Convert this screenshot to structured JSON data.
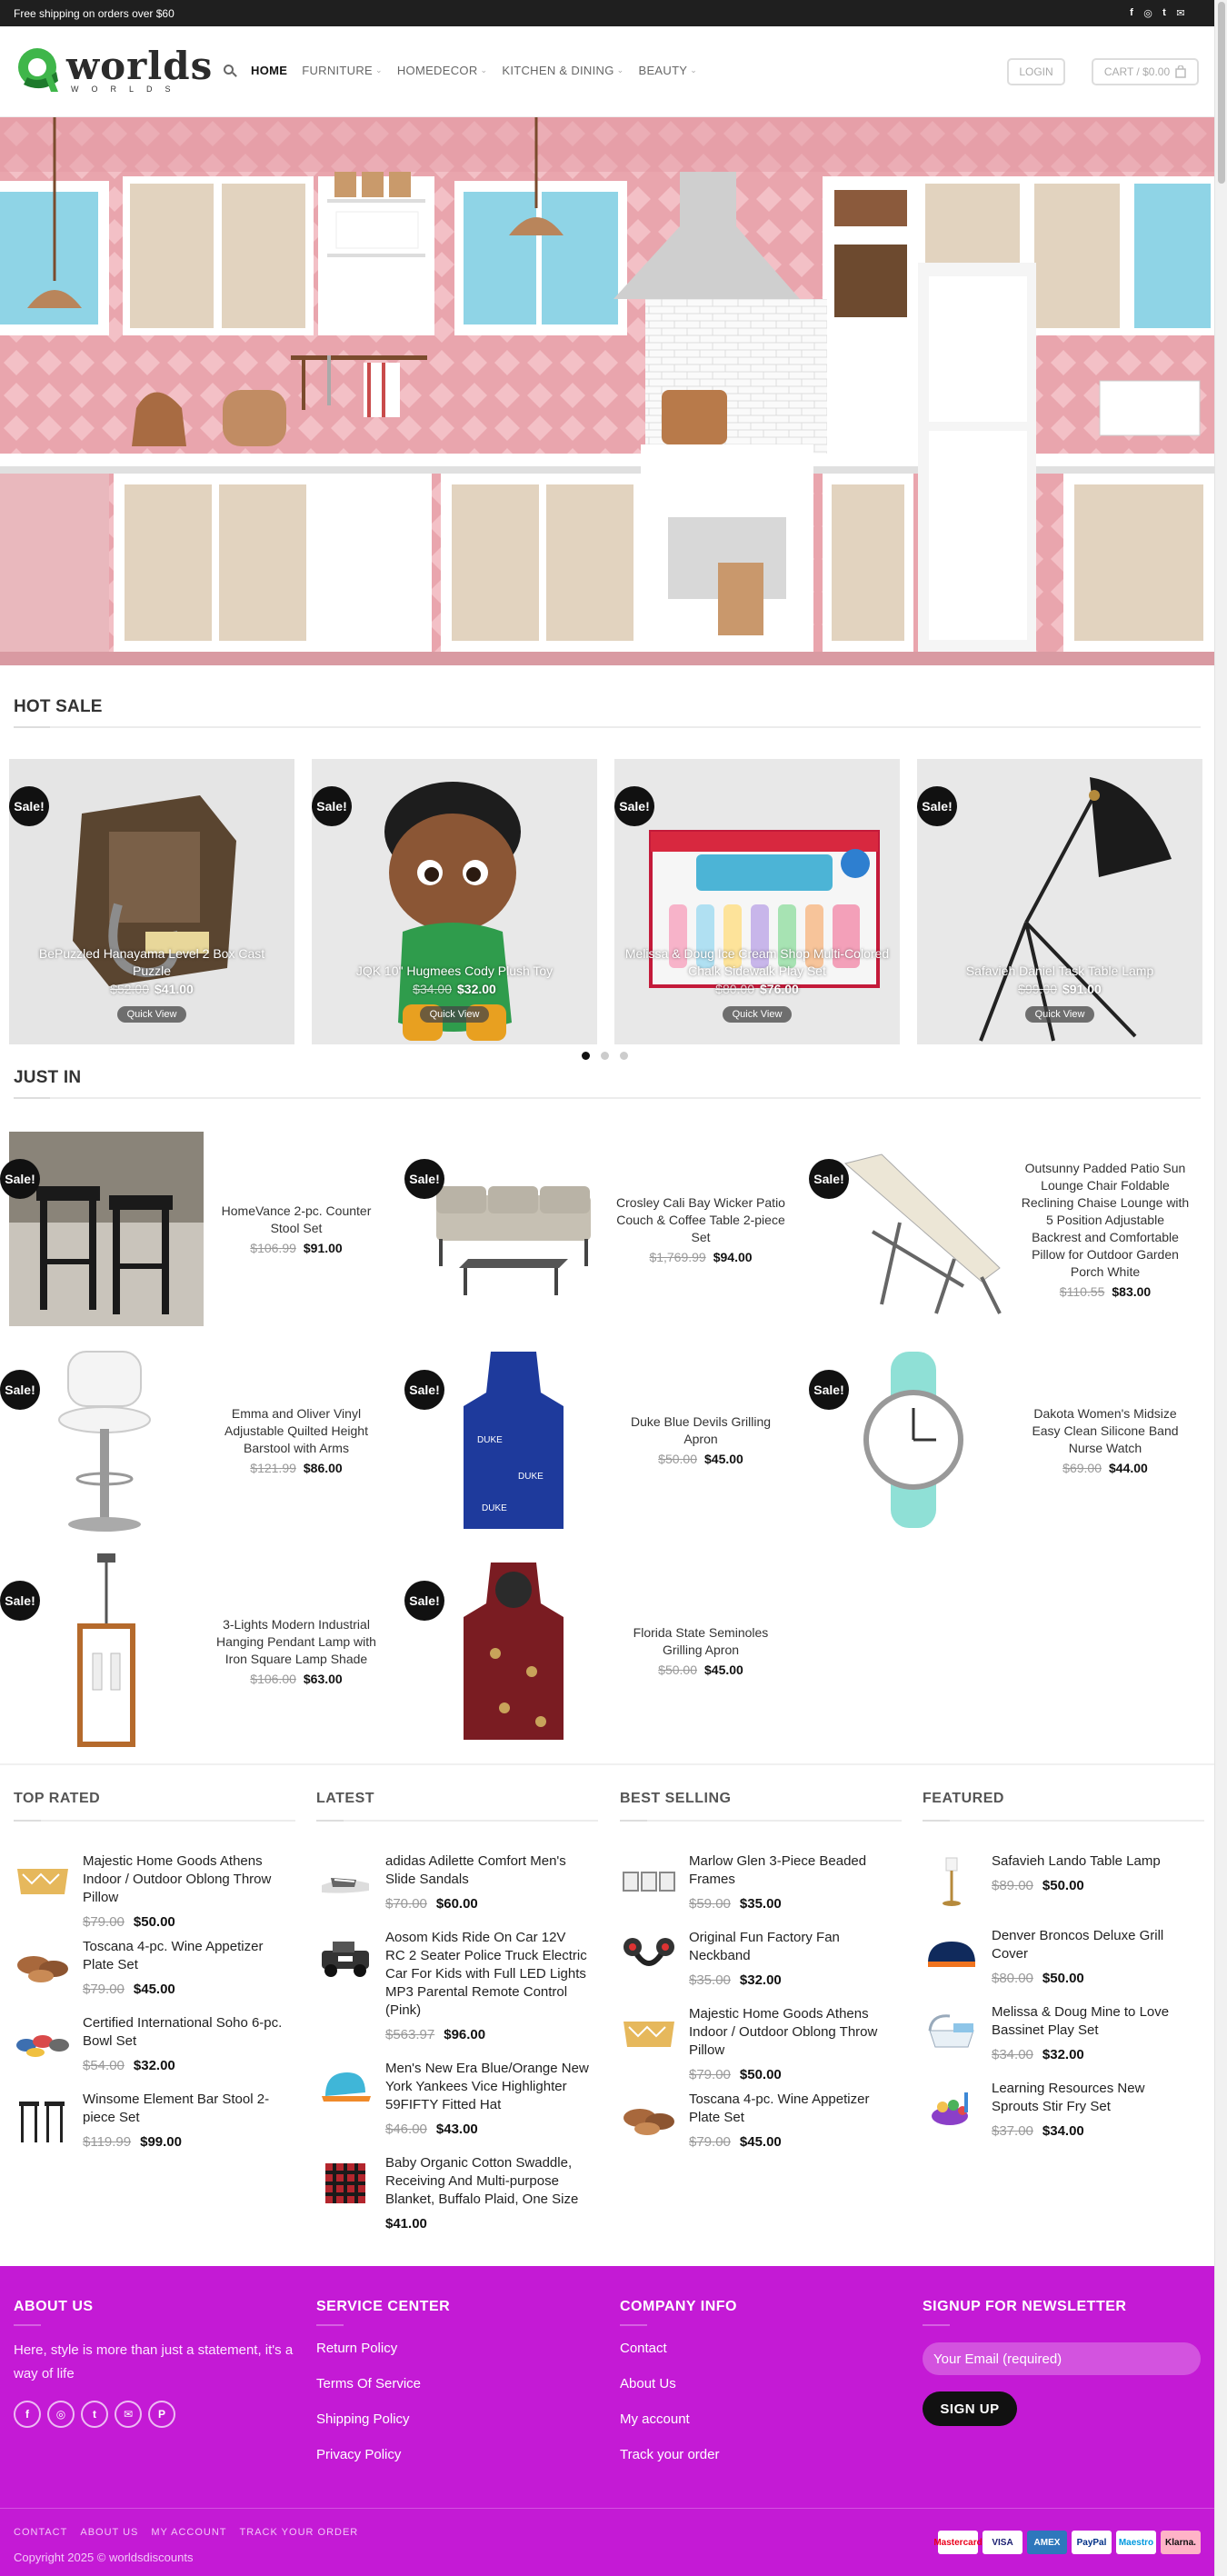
{
  "topbar": {
    "promo": "Free shipping on orders over $60",
    "socials": [
      "facebook-icon",
      "instagram-icon",
      "twitter-icon",
      "email-icon"
    ]
  },
  "brand": {
    "name": "worlds",
    "sub": "WORLDS",
    "accent": "#c41ad5"
  },
  "nav": {
    "items": [
      {
        "label": "HOME",
        "dropdown": false,
        "active": true
      },
      {
        "label": "FURNITURE",
        "dropdown": true
      },
      {
        "label": "HOMEDECOR",
        "dropdown": true
      },
      {
        "label": "KITCHEN & DINING",
        "dropdown": true
      },
      {
        "label": "BEAUTY",
        "dropdown": true
      }
    ],
    "login": "LOGIN",
    "cart": "CART / $0.00"
  },
  "hot_sale": {
    "title": "HOT SALE",
    "badge": "Sale!",
    "quick_view": "Quick View",
    "products": [
      {
        "name": "BePuzzled Hanayama Level 2 Box Cast Puzzle",
        "old": "$52.00",
        "price": "$41.00"
      },
      {
        "name": "JQK 10\" Hugmees Cody Plush Toy",
        "old": "$34.00",
        "price": "$32.00"
      },
      {
        "name": "Melissa & Doug Ice Cream Shop Multi-Colored Chalk Sidewalk Play Set",
        "old": "$80.00",
        "price": "$76.00"
      },
      {
        "name": "Safavieh Daniel Task Table Lamp",
        "old": "$99.00",
        "price": "$91.00"
      }
    ]
  },
  "just_in": {
    "title": "JUST IN",
    "products": [
      {
        "name": "HomeVance 2-pc. Counter Stool Set",
        "old": "$106.99",
        "price": "$91.00",
        "sale": true
      },
      {
        "name": "Crosley Cali Bay Wicker Patio Couch & Coffee Table 2-piece Set",
        "old": "$1,769.99",
        "price": "$94.00",
        "sale": true
      },
      {
        "name": "Outsunny Padded Patio Sun Lounge Chair Foldable Reclining Chaise Lounge with 5 Position Adjustable Backrest and Comfortable Pillow for Outdoor Garden Porch White",
        "old": "$110.55",
        "price": "$83.00",
        "sale": true
      },
      {
        "name": "Emma and Oliver Vinyl Adjustable Quilted Height Barstool with Arms",
        "old": "$121.99",
        "price": "$86.00",
        "sale": true
      },
      {
        "name": "Duke Blue Devils Grilling Apron",
        "old": "$50.00",
        "price": "$45.00",
        "sale": true
      },
      {
        "name": "Dakota Women's Midsize Easy Clean Silicone Band Nurse Watch",
        "old": "$69.00",
        "price": "$44.00",
        "sale": true
      },
      {
        "name": "3-Lights Modern Industrial Hanging Pendant Lamp with Iron Square Lamp Shade",
        "old": "$106.00",
        "price": "$63.00",
        "sale": true
      },
      {
        "name": "Florida State Seminoles Grilling Apron",
        "old": "$50.00",
        "price": "$45.00",
        "sale": true
      }
    ]
  },
  "widgets": [
    {
      "title": "TOP RATED",
      "items": [
        {
          "name": "Majestic Home Goods Athens Indoor / Outdoor Oblong Throw Pillow",
          "old": "$79.00",
          "price": "$50.00"
        },
        {
          "name": "Toscana 4-pc. Wine Appetizer Plate Set",
          "old": "$79.00",
          "price": "$45.00"
        },
        {
          "name": "Certified International Soho 6-pc. Bowl Set",
          "old": "$54.00",
          "price": "$32.00"
        },
        {
          "name": "Winsome Element Bar Stool 2-piece Set",
          "old": "$119.99",
          "price": "$99.00"
        }
      ]
    },
    {
      "title": "LATEST",
      "items": [
        {
          "name": "adidas Adilette Comfort Men's Slide Sandals",
          "old": "$70.00",
          "price": "$60.00"
        },
        {
          "name": "Aosom Kids Ride On Car 12V RC 2 Seater Police Truck Electric Car For Kids with Full LED Lights MP3 Parental Remote Control (Pink)",
          "old": "$563.97",
          "price": "$96.00"
        },
        {
          "name": "Men's New Era Blue/Orange New York Yankees Vice Highlighter 59FIFTY Fitted Hat",
          "old": "$46.00",
          "price": "$43.00"
        },
        {
          "name": "Baby Organic Cotton Swaddle, Receiving And Multi-purpose Blanket, Buffalo Plaid, One Size",
          "old": "",
          "price": "$41.00"
        }
      ]
    },
    {
      "title": "BEST SELLING",
      "items": [
        {
          "name": "Marlow Glen 3-Piece Beaded Frames",
          "old": "$59.00",
          "price": "$35.00"
        },
        {
          "name": "Original Fun Factory Fan Neckband",
          "old": "$35.00",
          "price": "$32.00"
        },
        {
          "name": "Majestic Home Goods Athens Indoor / Outdoor Oblong Throw Pillow",
          "old": "$79.00",
          "price": "$50.00"
        },
        {
          "name": "Toscana 4-pc. Wine Appetizer Plate Set",
          "old": "$79.00",
          "price": "$45.00"
        }
      ]
    },
    {
      "title": "FEATURED",
      "items": [
        {
          "name": "Safavieh Lando Table Lamp",
          "old": "$89.00",
          "price": "$50.00"
        },
        {
          "name": "Denver Broncos Deluxe Grill Cover",
          "old": "$80.00",
          "price": "$50.00"
        },
        {
          "name": "Melissa & Doug Mine to Love Bassinet Play Set",
          "old": "$34.00",
          "price": "$32.00"
        },
        {
          "name": "Learning Resources New Sprouts Stir Fry Set",
          "old": "$37.00",
          "price": "$34.00"
        }
      ]
    }
  ],
  "footer": {
    "about_title": "ABOUT US",
    "about_text": "Here, style is more than just a statement, it's a way of life",
    "service_title": "SERVICE CENTER",
    "service_links": [
      "Return Policy",
      "Terms Of Service",
      "Shipping Policy",
      "Privacy Policy"
    ],
    "company_title": "COMPANY INFO",
    "company_links": [
      "Contact",
      "About Us",
      "My account",
      "Track your order"
    ],
    "newsletter_title": "SIGNUP FOR NEWSLETTER",
    "email_placeholder": "Your Email (required)",
    "signup": "SIGN UP",
    "bottom_links": [
      "CONTACT",
      "ABOUT US",
      "MY ACCOUNT",
      "TRACK YOUR ORDER"
    ],
    "copyright": "Copyright 2025 © worldsdiscounts",
    "payments": [
      "Mastercard",
      "VISA",
      "AMEX",
      "PayPal",
      "Maestro",
      "Klarna."
    ]
  }
}
